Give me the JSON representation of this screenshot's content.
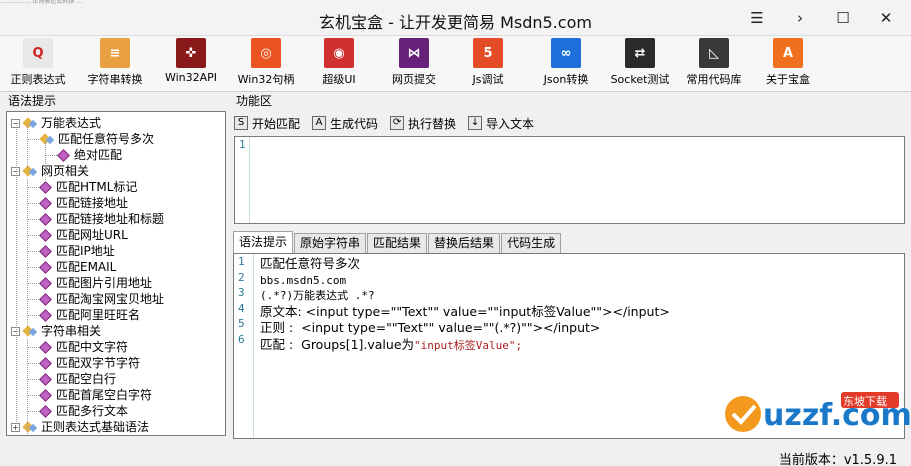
{
  "window": {
    "title": "玄机宝盒 - 让开发更简易 Msdn5.com",
    "top_strip": "................ 正则表达式转换 ... ",
    "controls": {
      "menu": "☰",
      "forward": "›",
      "maximize": "☐",
      "close": "✕"
    }
  },
  "toolbar": {
    "items": [
      {
        "label": "正则表达式",
        "icon": "regex-icon",
        "color": "#e8e8e8",
        "glyph": "Q"
      },
      {
        "label": "字符串转换",
        "icon": "bars-icon",
        "color": "#e8a040",
        "glyph": "≡"
      },
      {
        "label": "Win32API",
        "icon": "joystick-icon",
        "color": "#8a1a1a",
        "glyph": "✜"
      },
      {
        "label": "Win32句柄",
        "icon": "ubuntu-icon",
        "color": "#e95420",
        "glyph": "◎"
      },
      {
        "label": "超级UI",
        "icon": "chrome-icon",
        "color": "#d03030",
        "glyph": "◉"
      },
      {
        "label": "网页提交",
        "icon": "visualstudio-icon",
        "color": "#68217a",
        "glyph": "⋈"
      },
      {
        "label": "Js调试",
        "icon": "html5-icon",
        "color": "#e34c26",
        "glyph": "5"
      },
      {
        "label": "Json转换",
        "icon": "link-icon",
        "color": "#1e6fd9",
        "glyph": "∞"
      },
      {
        "label": "Socket测试",
        "icon": "socket-icon",
        "color": "#2a2a2a",
        "glyph": "⇄"
      },
      {
        "label": "常用代码库",
        "icon": "ruler-icon",
        "color": "#3a3a3a",
        "glyph": "◺"
      },
      {
        "label": "关于宝盒",
        "icon": "about-icon",
        "color": "#f07020",
        "glyph": "A"
      }
    ]
  },
  "left_panel": {
    "title": "语法提示",
    "tree": [
      {
        "label": "万能表达式",
        "level": 0,
        "expander": "−"
      },
      {
        "label": "匹配任意符号多次",
        "level": 1,
        "group": true
      },
      {
        "label": "绝对匹配",
        "level": 2
      },
      {
        "label": "网页相关",
        "level": 0,
        "expander": "−"
      },
      {
        "label": "匹配HTML标记",
        "level": 1
      },
      {
        "label": "匹配链接地址",
        "level": 1
      },
      {
        "label": "匹配链接地址和标题",
        "level": 1
      },
      {
        "label": "匹配网址URL",
        "level": 1
      },
      {
        "label": "匹配IP地址",
        "level": 1
      },
      {
        "label": "匹配EMAIL",
        "level": 1
      },
      {
        "label": "匹配图片引用地址",
        "level": 1
      },
      {
        "label": "匹配淘宝网宝贝地址",
        "level": 1
      },
      {
        "label": "匹配阿里旺旺名",
        "level": 1
      },
      {
        "label": "字符串相关",
        "level": 0,
        "expander": "−"
      },
      {
        "label": "匹配中文字符",
        "level": 1
      },
      {
        "label": "匹配双字节字符",
        "level": 1
      },
      {
        "label": "匹配空白行",
        "level": 1
      },
      {
        "label": "匹配首尾空白字符",
        "level": 1
      },
      {
        "label": "匹配多行文本",
        "level": 1
      },
      {
        "label": "正则表达式基础语法",
        "level": 0,
        "expander": "+"
      }
    ]
  },
  "func_panel": {
    "title": "功能区",
    "buttons": [
      {
        "label": "开始匹配",
        "glyph": "S"
      },
      {
        "label": "生成代码",
        "glyph": "A"
      },
      {
        "label": "执行替换",
        "glyph": "⟳"
      },
      {
        "label": "导入文本",
        "glyph": "↓"
      }
    ],
    "input_lines": [
      "1"
    ]
  },
  "result_tabs": [
    "语法提示",
    "原始字符串",
    "匹配结果",
    "替换后结果",
    "代码生成"
  ],
  "code_lines": [
    {
      "num": "1",
      "text": "匹配任意符号多次"
    },
    {
      "num": "2",
      "text": "bbs.msdn5.com"
    },
    {
      "num": "3",
      "text": "(.*?)万能表达式 .*?"
    },
    {
      "num": "4",
      "text": "原文本: <input type=\"\"Text\"\" value=\"\"input标签Value\"\"></input>"
    },
    {
      "num": "5",
      "text": "正则 :  <input type=\"\"Text\"\" value=\"\"(.*?)\"\"></input>"
    },
    {
      "num": "6",
      "text": "匹配 :  Groups[1].value为",
      "highlight": "\"input标签Value\";"
    }
  ],
  "status": {
    "version": "当前版本：v1.5.9.1"
  },
  "watermark": {
    "brand": "uzzf.com",
    "tag": "东坡下载"
  }
}
